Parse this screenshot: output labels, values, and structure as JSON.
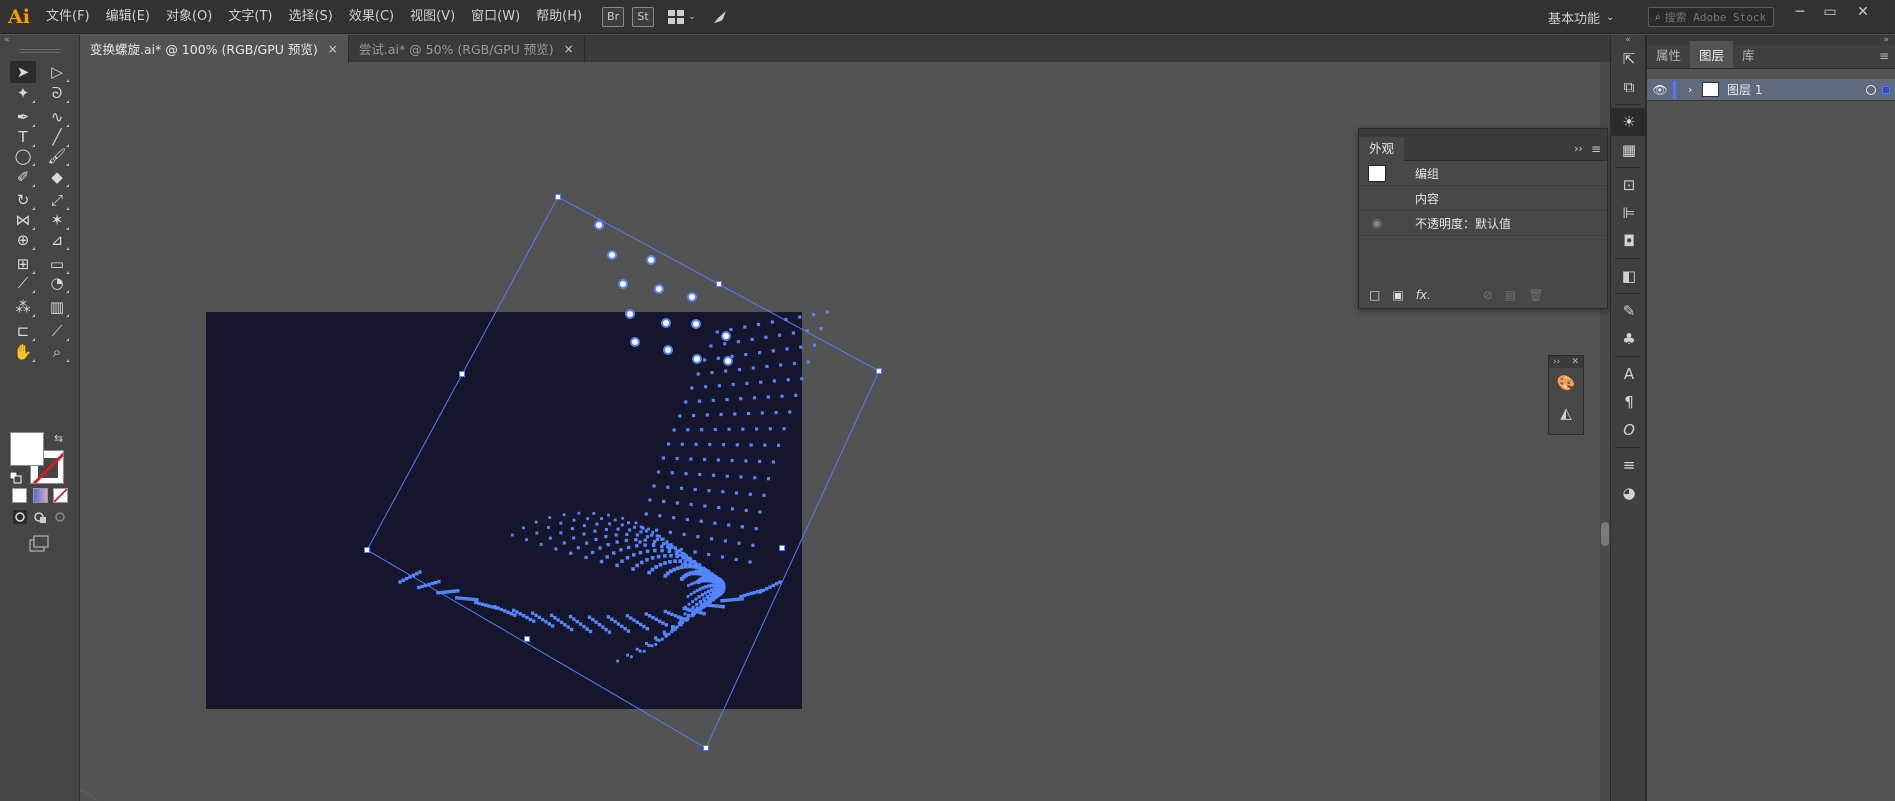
{
  "app": {
    "logo": "Ai"
  },
  "menus": [
    "文件(F)",
    "编辑(E)",
    "对象(O)",
    "文字(T)",
    "选择(S)",
    "效果(C)",
    "视图(V)",
    "窗口(W)",
    "帮助(H)"
  ],
  "menubar": {
    "bridge": "Br",
    "stock": "St",
    "workspace": "基本功能",
    "search_placeholder": "搜索 Adobe Stock"
  },
  "tabs": [
    {
      "label": "变换螺旋.ai* @ 100% (RGB/GPU 预览)",
      "close": "×",
      "active": true
    },
    {
      "label": "尝试.ai* @ 50% (RGB/GPU 预览)",
      "close": "×",
      "active": false
    }
  ],
  "appearance": {
    "title": "外观",
    "rows": [
      {
        "label": "编组"
      },
      {
        "label": "内容"
      },
      {
        "label": "不透明度：默认值"
      }
    ],
    "fx": "fx."
  },
  "layers_panel": {
    "tabs": [
      "属性",
      "图层",
      "库"
    ],
    "active_tab": "图层",
    "layers": [
      {
        "name": "图层 1",
        "color": "#4d78ff"
      }
    ]
  },
  "colors": {
    "artboard": "#15162b",
    "dots": "#5286ff",
    "selection": "#4f7cff",
    "panel_bg": "#535353"
  },
  "icons": [
    "selection-tool-icon",
    "direct-selection-tool-icon",
    "magic-wand-icon",
    "lasso-icon",
    "pen-icon",
    "curvature-icon",
    "type-icon",
    "line-icon",
    "ellipse-icon",
    "paintbrush-icon",
    "shaper-icon",
    "eraser-icon",
    "rotate-icon",
    "scale-icon",
    "width-icon",
    "puppet-warp-icon",
    "shape-builder-icon",
    "perspective-icon",
    "mesh-icon",
    "gradient-icon",
    "eyedropper-icon",
    "blend-icon",
    "symbol-sprayer-icon",
    "column-graph-icon",
    "artboard-icon",
    "slice-icon",
    "hand-icon",
    "zoom-icon"
  ]
}
